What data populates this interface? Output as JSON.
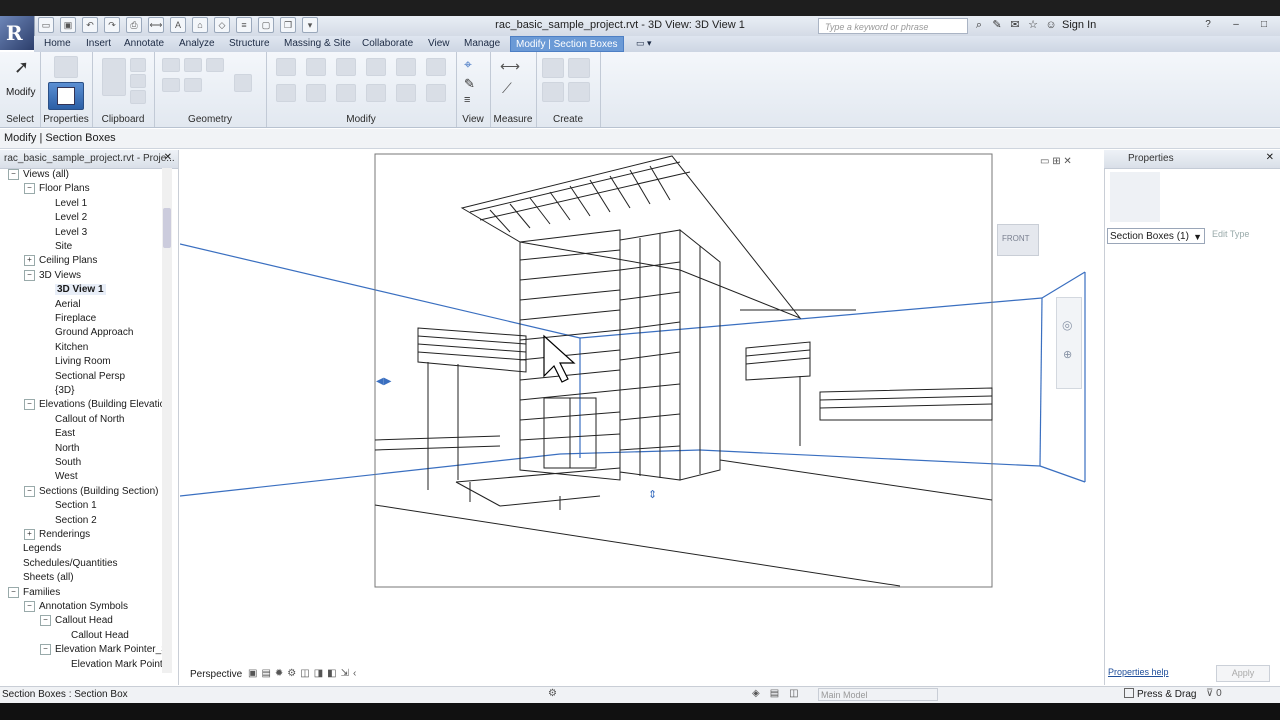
{
  "window_title": "rac_basic_sample_project.rvt - 3D View: 3D View 1",
  "search_placeholder": "Type a keyword or phrase",
  "sign_in": "Sign In",
  "ribbon_tabs": [
    {
      "label": "Home"
    },
    {
      "label": "Insert"
    },
    {
      "label": "Annotate"
    },
    {
      "label": "Analyze"
    },
    {
      "label": "Structure"
    },
    {
      "label": "Massing & Site"
    },
    {
      "label": "Collaborate"
    },
    {
      "label": "View"
    },
    {
      "label": "Manage"
    },
    {
      "label": "Modify | Section Boxes"
    }
  ],
  "ribbon_panels": {
    "modify_label": "Modify",
    "select": "Select",
    "properties": "Properties",
    "clipboard": "Clipboard",
    "geometry": "Geometry",
    "modify": "Modify",
    "view": "View",
    "measure": "Measure",
    "create": "Create"
  },
  "option_bar": "Modify | Section Boxes",
  "project_browser": {
    "title": "rac_basic_sample_project.rvt - Proje...",
    "items": [
      {
        "label": "Views (all)",
        "level": 0,
        "expander": "−"
      },
      {
        "label": "Floor Plans",
        "level": 1,
        "expander": "−"
      },
      {
        "label": "Level 1",
        "level": 2,
        "expander": ""
      },
      {
        "label": "Level 2",
        "level": 2,
        "expander": ""
      },
      {
        "label": "Level 3",
        "level": 2,
        "expander": ""
      },
      {
        "label": "Site",
        "level": 2,
        "expander": ""
      },
      {
        "label": "Ceiling Plans",
        "level": 1,
        "expander": "+"
      },
      {
        "label": "3D Views",
        "level": 1,
        "expander": "−"
      },
      {
        "label": "3D View 1",
        "level": 2,
        "expander": "",
        "selected": true
      },
      {
        "label": "Aerial",
        "level": 2,
        "expander": ""
      },
      {
        "label": "Fireplace",
        "level": 2,
        "expander": ""
      },
      {
        "label": "Ground Approach",
        "level": 2,
        "expander": ""
      },
      {
        "label": "Kitchen",
        "level": 2,
        "expander": ""
      },
      {
        "label": "Living Room",
        "level": 2,
        "expander": ""
      },
      {
        "label": "Sectional Persp",
        "level": 2,
        "expander": ""
      },
      {
        "label": "{3D}",
        "level": 2,
        "expander": ""
      },
      {
        "label": "Elevations (Building Elevatio",
        "level": 1,
        "expander": "−"
      },
      {
        "label": "Callout of North",
        "level": 2,
        "expander": ""
      },
      {
        "label": "East",
        "level": 2,
        "expander": ""
      },
      {
        "label": "North",
        "level": 2,
        "expander": ""
      },
      {
        "label": "South",
        "level": 2,
        "expander": ""
      },
      {
        "label": "West",
        "level": 2,
        "expander": ""
      },
      {
        "label": "Sections (Building Section)",
        "level": 1,
        "expander": "−"
      },
      {
        "label": "Section 1",
        "level": 2,
        "expander": ""
      },
      {
        "label": "Section 2",
        "level": 2,
        "expander": ""
      },
      {
        "label": "Renderings",
        "level": 1,
        "expander": "+"
      },
      {
        "label": "Legends",
        "level": 0,
        "expander": ""
      },
      {
        "label": "Schedules/Quantities",
        "level": 0,
        "expander": ""
      },
      {
        "label": "Sheets (all)",
        "level": 0,
        "expander": ""
      },
      {
        "label": "Families",
        "level": 0,
        "expander": "−"
      },
      {
        "label": "Annotation Symbols",
        "level": 1,
        "expander": "−"
      },
      {
        "label": "Callout Head",
        "level": 2,
        "expander": "−"
      },
      {
        "label": "Callout Head",
        "level": 3,
        "expander": ""
      },
      {
        "label": "Elevation Mark Pointer_S",
        "level": 2,
        "expander": "−"
      },
      {
        "label": "Elevation Mark Point",
        "level": 3,
        "expander": ""
      }
    ]
  },
  "view_control_bar": {
    "perspective": "Perspective"
  },
  "viewcube_label": "FRONT",
  "properties": {
    "title": "Properties",
    "type_selector": "Section Boxes (1)",
    "edit_type": "Edit Type",
    "help_link": "Properties help",
    "apply": "Apply"
  },
  "status": {
    "text": "Section Boxes : Section Box",
    "model": "Main Model",
    "press_drag": "Press & Drag"
  },
  "colors": {
    "accent": "#6b9ad6",
    "section_box": "#3a6fc0"
  }
}
